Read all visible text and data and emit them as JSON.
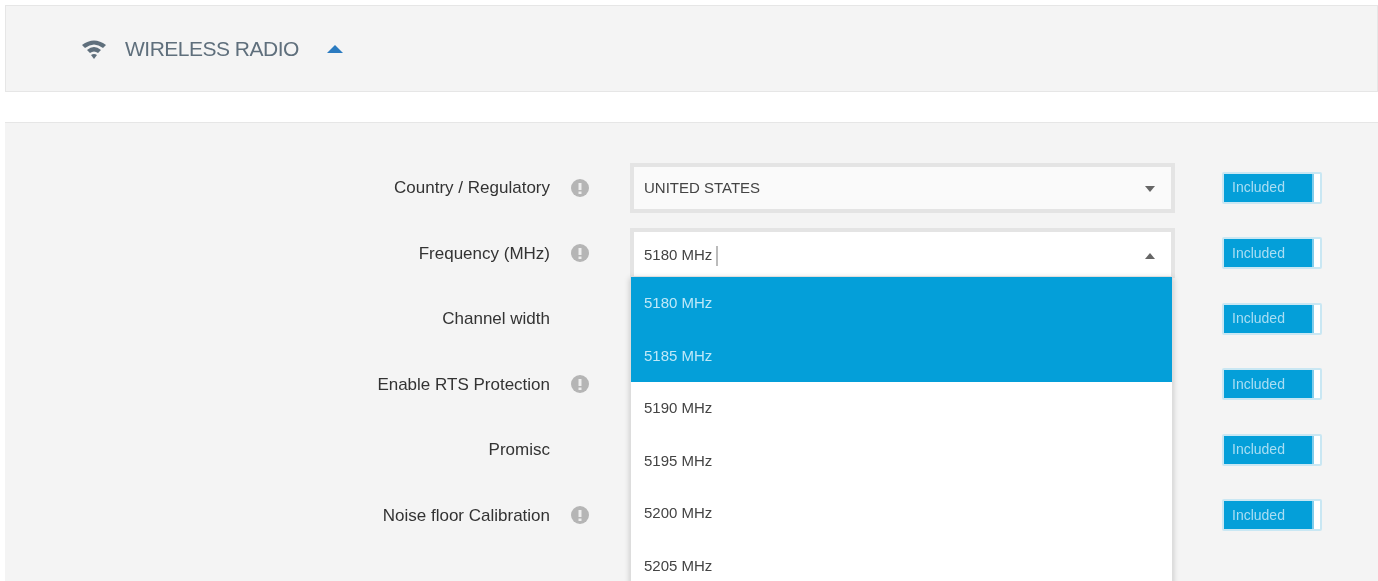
{
  "section": {
    "title": "WIRELESS RADIO",
    "expanded": true
  },
  "rows": [
    {
      "label": "Country / Regulatory",
      "help": true,
      "field": {
        "kind": "select",
        "value": "UNITED STATES",
        "open": false
      },
      "toggle": {
        "label": "Included",
        "on": true
      }
    },
    {
      "label": "Frequency (MHz)",
      "help": true,
      "field": {
        "kind": "search",
        "value": "5180 MHz",
        "open": true
      },
      "toggle": {
        "label": "Included",
        "on": true
      }
    },
    {
      "label": "Channel width",
      "help": false,
      "toggle": {
        "label": "Included",
        "on": true
      }
    },
    {
      "label": "Enable RTS Protection",
      "help": true,
      "toggle": {
        "label": "Included",
        "on": true
      }
    },
    {
      "label": "Promisc",
      "help": false,
      "toggle": {
        "label": "Included",
        "on": true
      }
    },
    {
      "label": "Noise floor Calibration",
      "help": true,
      "toggle": {
        "label": "Included",
        "on": true
      }
    }
  ],
  "dropdown": {
    "options": [
      {
        "label": "5180 MHz",
        "selected": true
      },
      {
        "label": "5185 MHz",
        "selected": true
      },
      {
        "label": "5190 MHz",
        "selected": false
      },
      {
        "label": "5195 MHz",
        "selected": false
      },
      {
        "label": "5200 MHz",
        "selected": false
      },
      {
        "label": "5205 MHz",
        "selected": false
      }
    ]
  }
}
